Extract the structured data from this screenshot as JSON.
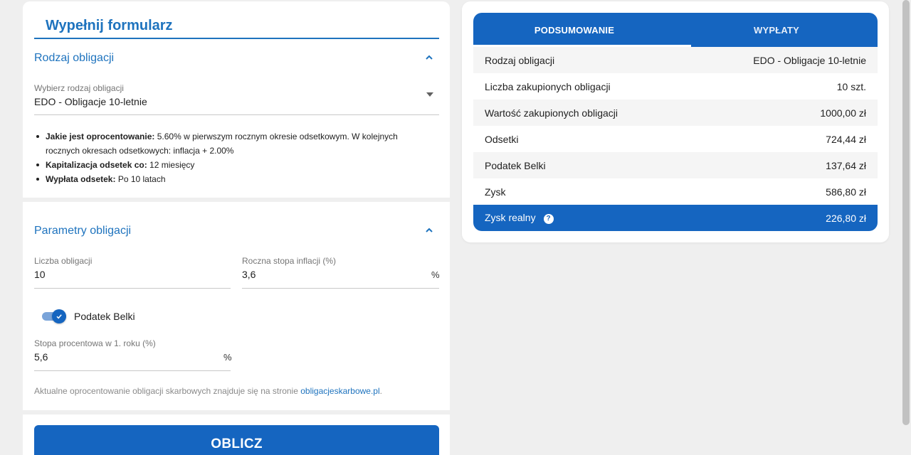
{
  "form": {
    "title": "Wypełnij formularz",
    "bond_type_section": {
      "title": "Rodzaj obligacji",
      "select_label": "Wybierz rodzaj obligacji",
      "select_value": "EDO - Obligacje 10-letnie",
      "info": [
        {
          "label": "Jakie jest oprocentowanie:",
          "text": " 5.60% w pierwszym rocznym okresie odsetkowym. W kolejnych rocznych okresach odsetkowych: inflacja + 2.00%"
        },
        {
          "label": "Kapitalizacja odsetek co:",
          "text": " 12 miesięcy"
        },
        {
          "label": "Wypłata odsetek:",
          "text": " Po 10 latach"
        }
      ]
    },
    "params_section": {
      "title": "Parametry obligacji",
      "count_label": "Liczba obligacji",
      "count_value": "10",
      "inflation_label": "Roczna stopa inflacji (%)",
      "inflation_value": "3,6",
      "inflation_suffix": "%",
      "belka_toggle_label": "Podatek Belki",
      "belka_toggle_on": true,
      "rate_label": "Stopa procentowa w 1. roku (%)",
      "rate_value": "5,6",
      "rate_suffix": "%",
      "note_text": "Aktualne oprocentowanie obligacji skarbowych znajduje się na stronie ",
      "note_link": "obligacjeskarbowe.pl",
      "note_end": "."
    },
    "calculate_label": "OBLICZ"
  },
  "summary": {
    "tabs": [
      {
        "label": "PODSUMOWANIE",
        "active": true
      },
      {
        "label": "WYPŁATY",
        "active": false
      }
    ],
    "rows": [
      {
        "label": "Rodzaj obligacji",
        "value": "EDO - Obligacje 10-letnie"
      },
      {
        "label": "Liczba zakupionych obligacji",
        "value": "10 szt."
      },
      {
        "label": "Wartość zakupionych obligacji",
        "value": "1000,00 zł"
      },
      {
        "label": "Odsetki",
        "value": "724,44 zł"
      },
      {
        "label": "Podatek Belki",
        "value": "137,64 zł"
      },
      {
        "label": "Zysk",
        "value": "586,80 zł"
      }
    ],
    "final_row": {
      "label": "Zysk realny",
      "value": "226,80 zł",
      "help_icon": "?"
    }
  },
  "colors": {
    "primary": "#1565c0",
    "accent_text": "#1e73be",
    "background": "#efefef"
  }
}
